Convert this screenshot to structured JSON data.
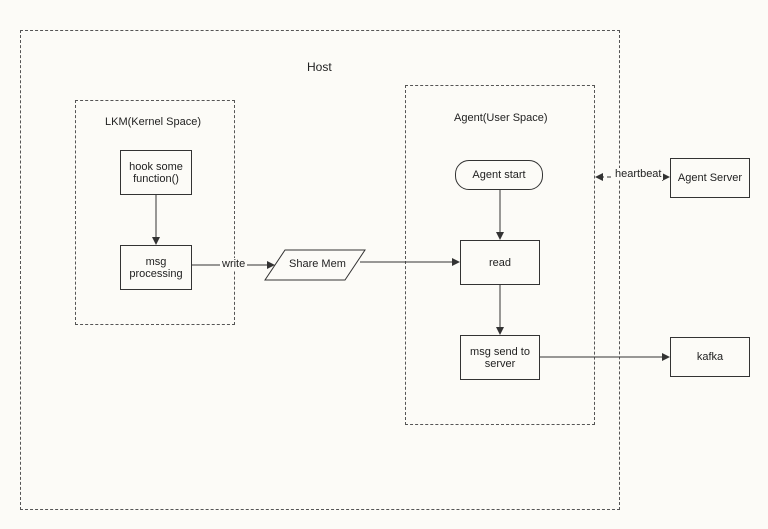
{
  "host": {
    "title": "Host"
  },
  "lkm": {
    "title": "LKM(Kernel Space)",
    "hook": "hook some function()",
    "msg_processing": "msg processing"
  },
  "agent": {
    "title": "Agent(User Space)",
    "start": "Agent start",
    "read": "read",
    "send": "msg send to server"
  },
  "share_mem": "Share Mem",
  "external": {
    "agent_server": "Agent Server",
    "kafka": "kafka"
  },
  "edges": {
    "write": "write",
    "heartbeat": "heartbeat"
  }
}
